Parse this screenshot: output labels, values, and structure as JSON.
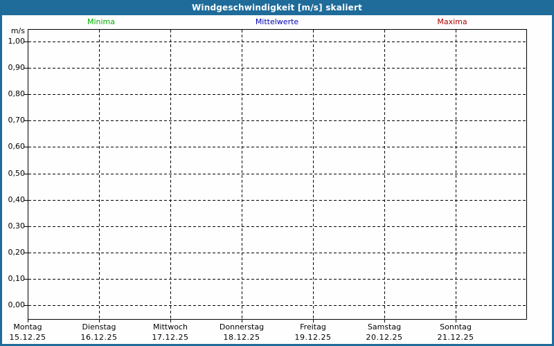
{
  "window": {
    "title": "Windgeschwindigkeit [m/s] skaliert"
  },
  "legend": {
    "minima": "Minima",
    "mittelwerte": "Mittelwerte",
    "maxima": "Maxima",
    "position": "top"
  },
  "colors": {
    "titlebar_and_frame": "#1F6B99",
    "title_text": "#FFFFFF",
    "minima": "#00AF00",
    "mittelwerte": "#0000B4",
    "maxima": "#B00000",
    "grid": "#000000",
    "plot_background": "#FDFEFD"
  },
  "chart_data": {
    "type": "line",
    "title": "Windgeschwindigkeit [m/s] skaliert",
    "ylabel": "m/s",
    "ylim": [
      0.0,
      1.0
    ],
    "ytick_step": 0.1,
    "ytick_labels_top_to_bottom": [
      "1,00",
      "0,90",
      "0,80",
      "0,70",
      "0,60",
      "0,50",
      "0,40",
      "0,30",
      "0,20",
      "0,10",
      "0,00"
    ],
    "categories": [
      {
        "day": "Montag",
        "date": "15.12.25"
      },
      {
        "day": "Dienstag",
        "date": "16.12.25"
      },
      {
        "day": "Mittwoch",
        "date": "17.12.25"
      },
      {
        "day": "Donnerstag",
        "date": "18.12.25"
      },
      {
        "day": "Freitag",
        "date": "19.12.25"
      },
      {
        "day": "Samstag",
        "date": "20.12.25"
      },
      {
        "day": "Sonntag",
        "date": "21.12.25"
      }
    ],
    "series": [
      {
        "name": "Minima",
        "color": "#00AF00",
        "values": []
      },
      {
        "name": "Mittelwerte",
        "color": "#0000B4",
        "values": []
      },
      {
        "name": "Maxima",
        "color": "#B00000",
        "values": []
      }
    ],
    "grid": {
      "horizontal": "dashed",
      "vertical": "dashed"
    },
    "legend_position": "top",
    "plot_is_empty": true
  }
}
